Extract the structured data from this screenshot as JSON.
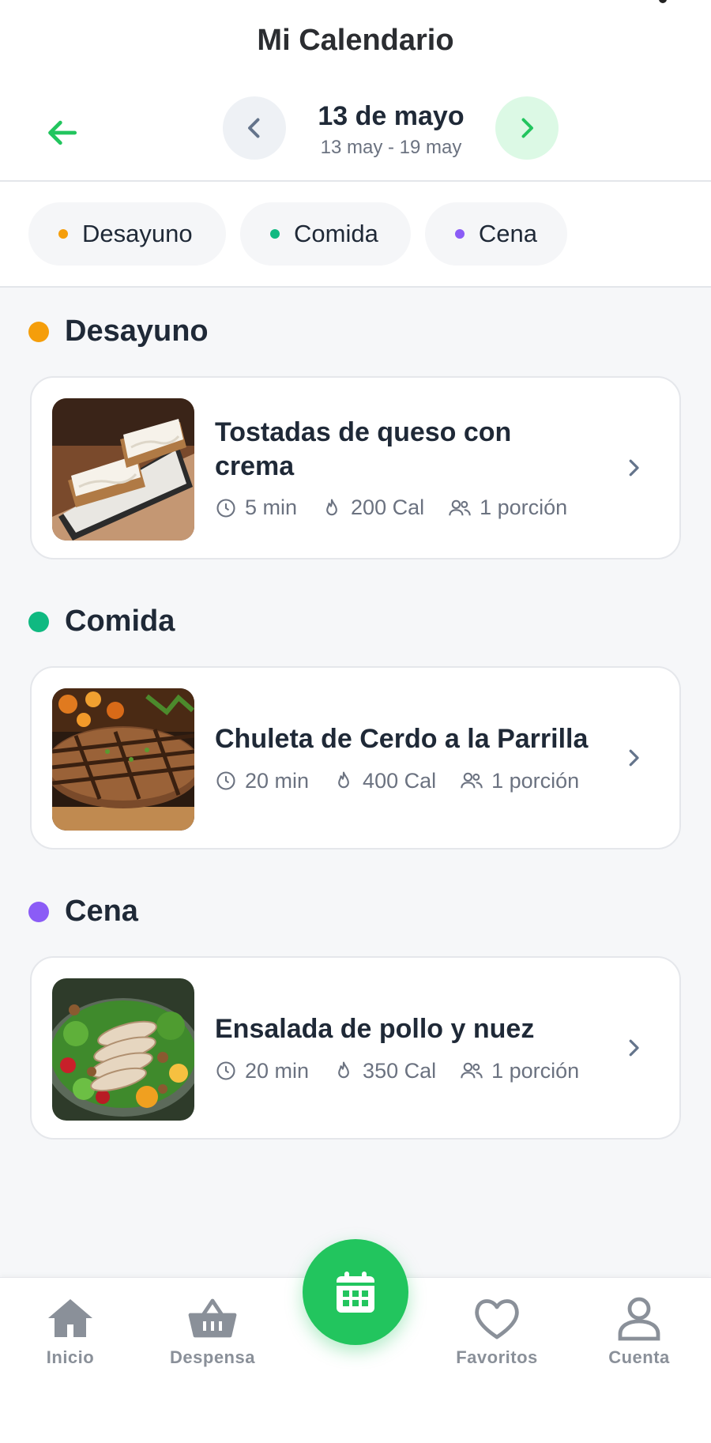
{
  "header": {
    "title": "Mi Calendario"
  },
  "week": {
    "date": "13 de mayo",
    "range": "13 may - 19 may"
  },
  "filters": [
    {
      "label": "Desayuno",
      "color": "#f59e0b"
    },
    {
      "label": "Comida",
      "color": "#10b981"
    },
    {
      "label": "Cena",
      "color": "#8b5cf6"
    }
  ],
  "sections": [
    {
      "title": "Desayuno",
      "color": "#f59e0b",
      "recipe": {
        "title": "Tostadas de queso con crema",
        "time": "5 min",
        "calories": "200 Cal",
        "servings": "1 porción"
      }
    },
    {
      "title": "Comida",
      "color": "#10b981",
      "recipe": {
        "title": "Chuleta de Cerdo a la Parrilla",
        "time": "20 min",
        "calories": "400 Cal",
        "servings": "1 porción"
      }
    },
    {
      "title": "Cena",
      "color": "#8b5cf6",
      "recipe": {
        "title": "Ensalada de pollo y nuez",
        "time": "20 min",
        "calories": "350 Cal",
        "servings": "1 porción"
      }
    }
  ],
  "nav": {
    "inicio": "Inicio",
    "despensa": "Despensa",
    "favoritos": "Favoritos",
    "cuenta": "Cuenta"
  },
  "colors": {
    "accent": "#22c55e",
    "nav_icon": "#8a9099"
  },
  "icons": [
    "arrow-left-icon",
    "chevron-left-icon",
    "chevron-right-icon",
    "clock-icon",
    "flame-icon",
    "users-icon",
    "home-icon",
    "basket-icon",
    "calendar-icon",
    "heart-icon",
    "user-icon"
  ]
}
